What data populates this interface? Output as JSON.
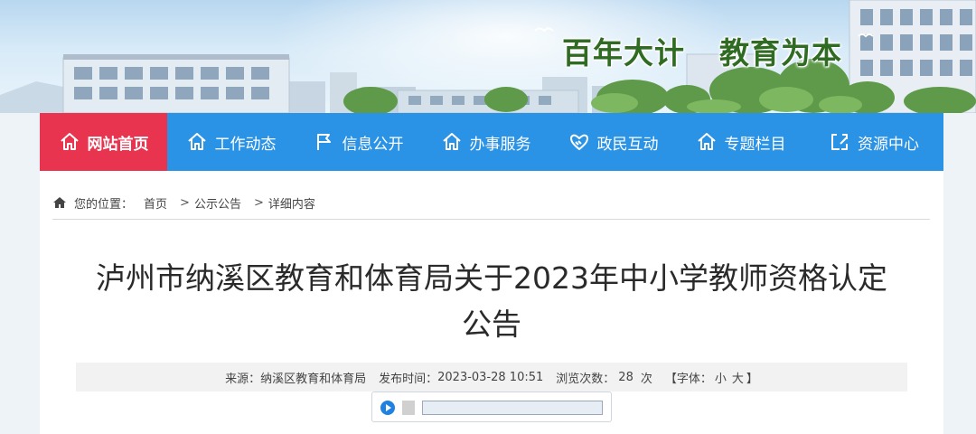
{
  "banner": {
    "slogan_left": "百年大计",
    "slogan_right": "教育为本"
  },
  "nav": {
    "items": [
      {
        "label": "网站首页",
        "icon": "home-icon",
        "active": true
      },
      {
        "label": "工作动态",
        "icon": "home-icon"
      },
      {
        "label": "信息公开",
        "icon": "flag-icon"
      },
      {
        "label": "办事服务",
        "icon": "home-icon"
      },
      {
        "label": "政民互动",
        "icon": "handshake-icon"
      },
      {
        "label": "专题栏目",
        "icon": "home-icon"
      },
      {
        "label": "资源中心",
        "icon": "folder-share-icon"
      }
    ]
  },
  "breadcrumb": {
    "lead": "您的位置：",
    "items": [
      "首页",
      "公示公告",
      "详细内容"
    ],
    "separator": ">"
  },
  "article": {
    "title_line1": "泸州市纳溪区教育和体育局关于2023年中小学教师资格认定",
    "title_line2": "公告",
    "source_label": "来源：",
    "source": "纳溪区教育和体育局",
    "publish_label": "发布时间：",
    "publish_time": "2023-03-28 10:51",
    "views_label": "浏览次数：",
    "views": "28",
    "views_unit": "次",
    "fontsize_prefix": "【字体：",
    "fontsize_small": "小",
    "fontsize_large": "大",
    "fontsize_suffix": "】"
  },
  "colors": {
    "nav_bg": "#2b93e6",
    "nav_active": "#e8344f",
    "slogan": "#2f6b23"
  }
}
